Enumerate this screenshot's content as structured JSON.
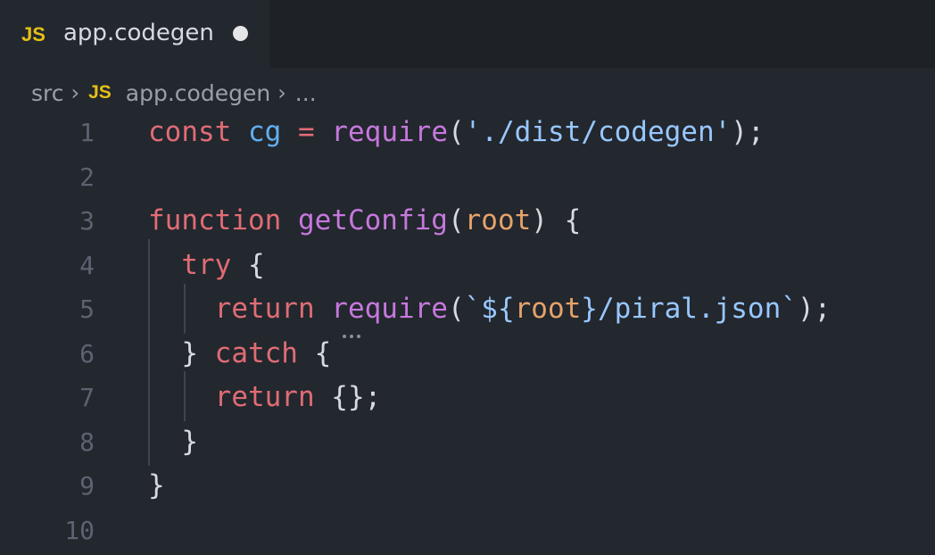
{
  "tab": {
    "lang_badge": "JS",
    "title": "app.codegen"
  },
  "breadcrumb": {
    "folder": "src",
    "lang_badge": "JS",
    "file": "app.codegen",
    "more": "..."
  },
  "colors": {
    "keyword": "#e06c75",
    "variable": "#61afef",
    "function": "#c678dd",
    "string": "#98c7ff",
    "parameter": "#e5a36a",
    "js_badge": "#e5c015"
  },
  "lines": [
    {
      "n": "1",
      "tokens": [
        [
          "kw",
          "const"
        ],
        [
          "pun",
          " "
        ],
        [
          "var",
          "cg"
        ],
        [
          "pun",
          " "
        ],
        [
          "kw",
          "="
        ],
        [
          "pun",
          " "
        ],
        [
          "fn",
          "require"
        ],
        [
          "pun",
          "("
        ],
        [
          "str",
          "'./dist/codegen'"
        ],
        [
          "pun",
          ");"
        ]
      ]
    },
    {
      "n": "2",
      "tokens": []
    },
    {
      "n": "3",
      "tokens": [
        [
          "kw",
          "function"
        ],
        [
          "pun",
          " "
        ],
        [
          "fn",
          "getConfig"
        ],
        [
          "pun",
          "("
        ],
        [
          "prm",
          "root"
        ],
        [
          "pun",
          ") {"
        ]
      ]
    },
    {
      "n": "4",
      "tokens": [
        [
          "pun",
          "  "
        ],
        [
          "kw",
          "try"
        ],
        [
          "pun",
          " {"
        ]
      ]
    },
    {
      "n": "5",
      "tokens": [
        [
          "pun",
          "    "
        ],
        [
          "kw",
          "return"
        ],
        [
          "pun",
          " "
        ],
        [
          "fn",
          "require"
        ],
        [
          "pun",
          "("
        ],
        [
          "str",
          "`${"
        ],
        [
          "prm",
          "root"
        ],
        [
          "str",
          "}/piral.json`"
        ],
        [
          "pun",
          ");"
        ]
      ]
    },
    {
      "n": "6",
      "tokens": [
        [
          "pun",
          "  } "
        ],
        [
          "kw",
          "catch"
        ],
        [
          "pun",
          " {"
        ]
      ]
    },
    {
      "n": "7",
      "tokens": [
        [
          "pun",
          "    "
        ],
        [
          "kw",
          "return"
        ],
        [
          "pun",
          " {};"
        ]
      ]
    },
    {
      "n": "8",
      "tokens": [
        [
          "pun",
          "  }"
        ]
      ]
    },
    {
      "n": "9",
      "tokens": [
        [
          "pun",
          "}"
        ]
      ]
    },
    {
      "n": "10",
      "tokens": []
    }
  ]
}
